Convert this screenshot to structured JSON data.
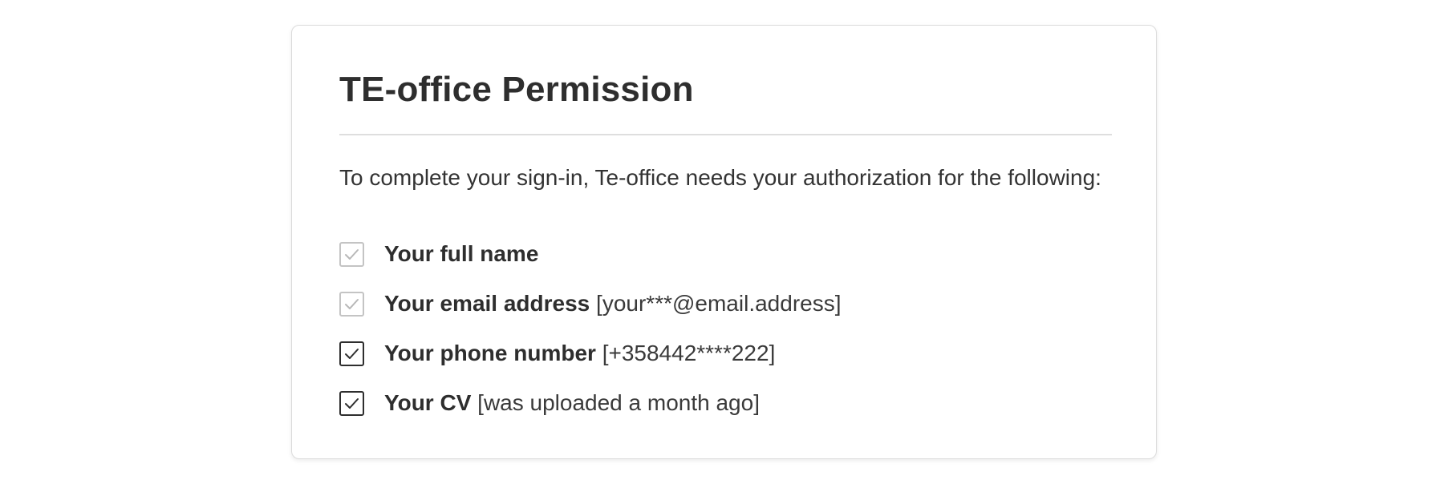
{
  "title": "TE-office Permission",
  "intro": "To complete your sign-in, Te-office needs your authorization for the following:",
  "permissions": [
    {
      "label": "Your full name",
      "detail": "",
      "checked": true,
      "disabled": true
    },
    {
      "label": "Your email address",
      "detail": "[your***@email.address]",
      "checked": true,
      "disabled": true
    },
    {
      "label": "Your phone number",
      "detail": "[+358442****222]",
      "checked": true,
      "disabled": false
    },
    {
      "label": "Your CV",
      "detail": "[was uploaded a month ago]",
      "checked": true,
      "disabled": false
    }
  ],
  "colors": {
    "check_enabled": "#2e2e2e",
    "check_disabled": "#b8b8b8"
  }
}
